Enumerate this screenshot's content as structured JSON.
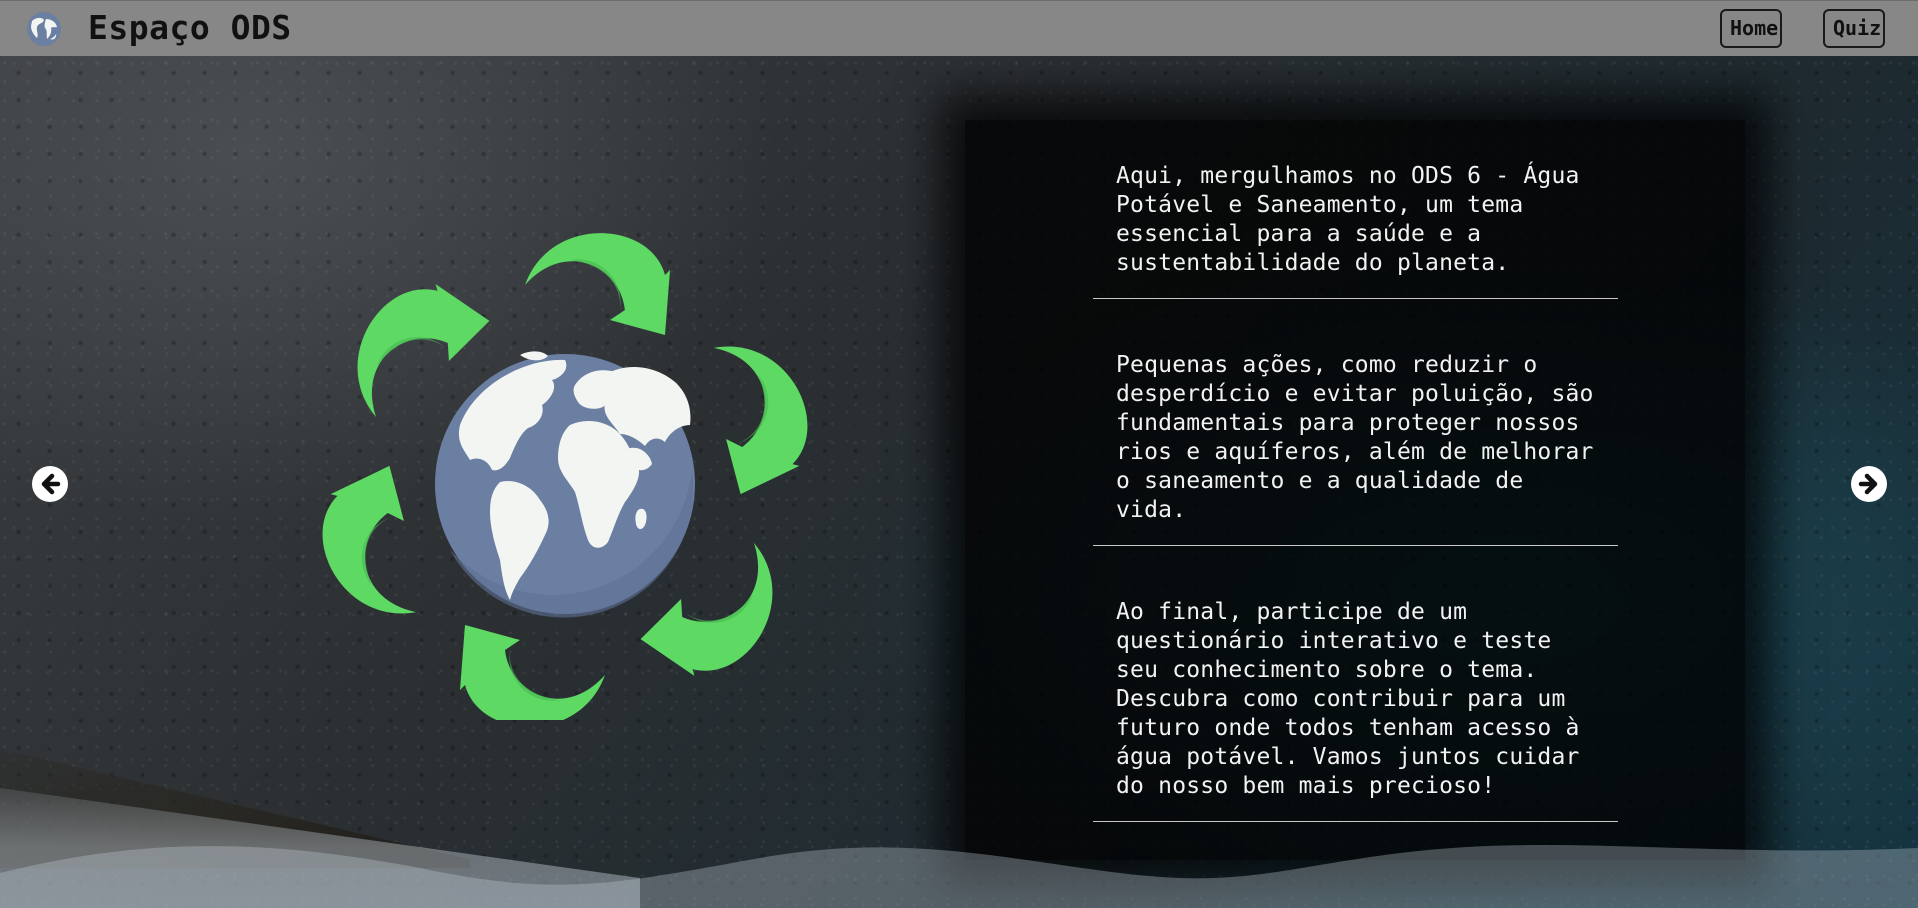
{
  "navbar": {
    "brand": "Espaço ODS",
    "home_label": "Home",
    "quiz_label": "Quiz"
  },
  "content": {
    "paragraphs": [
      "Aqui, mergulhamos no ODS 6 - Água Potável e Saneamento, um tema essencial para a saúde e a sustentabilidade do planeta.",
      "Pequenas ações, como reduzir o desperdício e evitar poluição, são fundamentais para proteger nossos rios e aquíferos, além de melhorar o saneamento e a qualidade de vida.",
      "Ao final, participe de um questionário interativo e teste seu conhecimento sobre o tema. Descubra como contribuir para um futuro onde todos tenham acesso à água potável. Vamos juntos cuidar do nosso bem mais precioso!"
    ]
  },
  "icons": {
    "logo": "globe-icon",
    "prev": "arrow-left-icon",
    "next": "arrow-right-icon",
    "illustration": "recycle-globe-icon"
  },
  "colors": {
    "navbar": "#878787",
    "arrow_green": "#5dd964",
    "globe_blue": "#6b7fa3",
    "land": "#f3f5f2"
  }
}
